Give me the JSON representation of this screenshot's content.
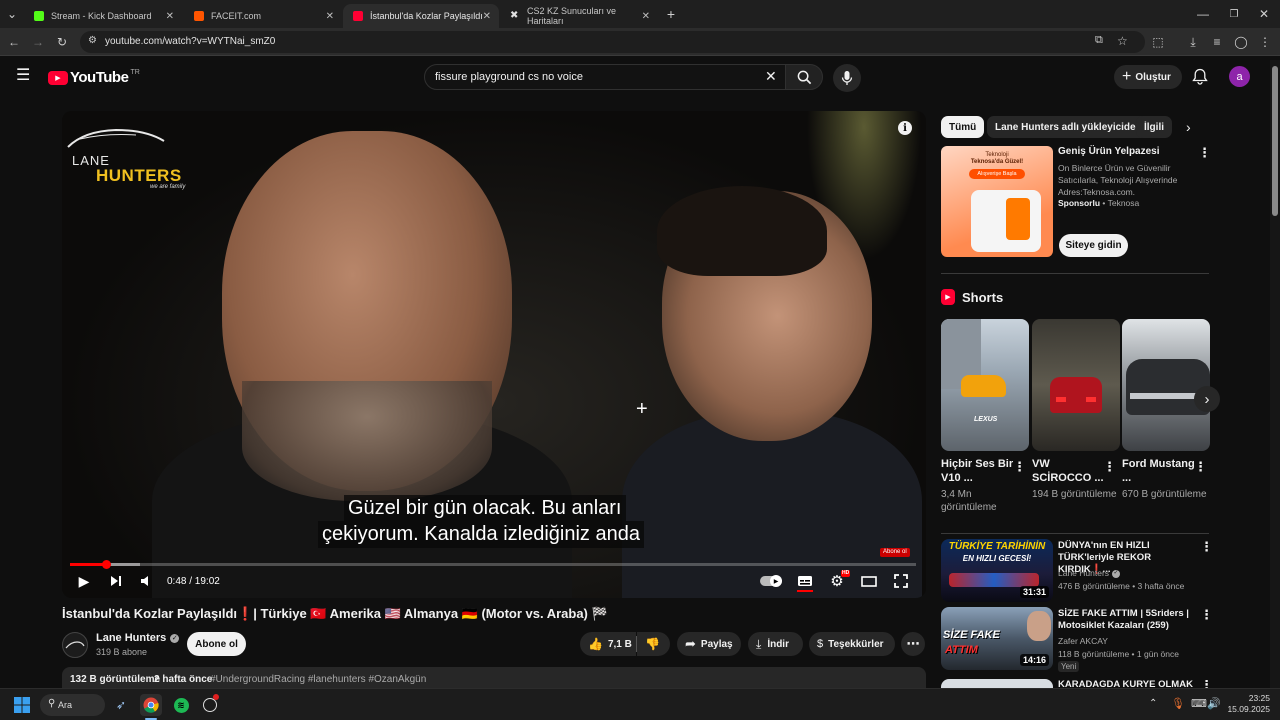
{
  "browser": {
    "tabs": [
      {
        "label": "Stream - Kick Dashboard",
        "color": "#53fc18"
      },
      {
        "label": "FACEIT.com",
        "color": "#ff5500"
      },
      {
        "label": "İstanbul'da Kozlar Paylaşıldı ❗ | Tür",
        "color": "#ff0033"
      },
      {
        "label": "CS2 KZ Sunucuları ve Haritaları",
        "color": "#e0e0e0"
      }
    ],
    "url": "youtube.com/watch?v=WYTNai_smZ0"
  },
  "header": {
    "logo_text": "YouTube",
    "region": "TR",
    "search_value": "fissure playground cs no voice",
    "create_label": "Oluştur",
    "avatar_letter": "a"
  },
  "video": {
    "channel_logo_line1": "LANE",
    "channel_logo_line2": "HUNTERS",
    "channel_logo_tagline": "we are family",
    "subtitle_line1": "Güzel bir gün olacak. Bu anları",
    "subtitle_line2": "çekiyorum. Kanalda izlediğiniz anda",
    "time": "0:48 / 19:02",
    "progress_fraction": 0.042,
    "subscribe_badge": "Abone ol",
    "hd_badge": "HD"
  },
  "info": {
    "title": "İstanbul'da Kozlar Paylaşıldı❗| Türkiye 🇹🇷 Amerika 🇺🇸 Almanya 🇩🇪 (Motor vs. Araba) 🏁",
    "channel": "Lane Hunters",
    "subscribers": "319 B abone",
    "subscribe_label": "Abone ol",
    "likes": "7,1 B",
    "share_label": "Paylaş",
    "download_label": "İndir",
    "thanks_label": "Teşekkürler",
    "views": "132 B görüntüleme",
    "age": "2 hafta önce",
    "hashtags": "#UndergroundRacing #lanehunters #OzanAkgün"
  },
  "sidebar": {
    "chips": [
      "Tümü",
      "Lane Hunters adlı yükleyiciden",
      "İlgili"
    ],
    "ad": {
      "image_text_line1": "Teknoloji",
      "image_text_line2": "Teknosa'da Güzel!",
      "image_button": "Alışverişe Başla",
      "title": "Geniş Ürün Yelpazesi",
      "description": "On Binlerce Ürün ve Güvenilir Satıcılarla, Teknoloji Alışverinde Adres:Teknosa.com.",
      "sponsor_label": "Sponsorlu",
      "sponsor_name": "Teknosa",
      "cta": "Siteye gidin"
    },
    "shorts_title": "Shorts",
    "shorts": [
      {
        "title": "Hiçbir Ses Bir V10 ...",
        "views": "3,4 Mn görüntüleme"
      },
      {
        "title": "VW SCİROCCO ...",
        "views": "194 B görüntüleme"
      },
      {
        "title": "Ford Mustang ...",
        "views": "670 B görüntüleme"
      }
    ],
    "videos": [
      {
        "title": "DÜNYA'nın EN HIZLI TÜRK'leriyle REKOR KIRDIK❗...",
        "channel": "Lane Hunters",
        "meta": "476 B görüntüleme • 3 hafta önce",
        "duration": "31:31",
        "thumb_text1": "TÜRKİYE TARİHİNİN",
        "thumb_text2": "EN HIZLI GECESİ!"
      },
      {
        "title": "SİZE FAKE ATTIM | 5Sriders | Motosiklet Kazaları (259)",
        "channel": "Zafer AKCAY",
        "meta": "118 B görüntüleme • 1 gün önce",
        "badge": "Yeni",
        "duration": "14:16",
        "thumb_text1": "SİZE FAKE",
        "thumb_text2": "ATTIM"
      },
      {
        "title": "KARADAĞDA KURYE OLMAK",
        "channel": "",
        "meta": ""
      }
    ]
  },
  "taskbar": {
    "search_label": "Ara",
    "time": "23:25",
    "date": "15.09.2025"
  }
}
